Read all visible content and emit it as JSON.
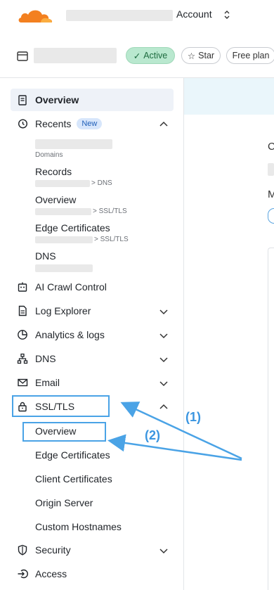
{
  "topbar": {
    "account_label": "Account",
    "chevron": "⌃⌄"
  },
  "zone": {
    "status": "Active",
    "star_label": "Star",
    "plan_label": "Free plan"
  },
  "sidebar": {
    "overview": "Overview",
    "recents": {
      "label": "Recents",
      "badge": "New",
      "items": [
        {
          "title": "",
          "sub": "Domains"
        },
        {
          "title": "Records",
          "sub": "> DNS"
        },
        {
          "title": "Overview",
          "sub": "> SSL/TLS"
        },
        {
          "title": "Edge Certificates",
          "sub": "> SSL/TLS"
        },
        {
          "title": "DNS",
          "sub": ""
        }
      ]
    },
    "items": {
      "ai_crawl": "AI Crawl Control",
      "log_explorer": "Log Explorer",
      "analytics": "Analytics & logs",
      "dns": "DNS",
      "email": "Email",
      "ssl": "SSL/TLS",
      "security": "Security",
      "access": "Access"
    },
    "ssl_sub": {
      "overview": "Overview",
      "edge": "Edge Certificates",
      "client": "Client Certificates",
      "origin": "Origin Server",
      "custom": "Custom Hostnames"
    }
  },
  "annotations": {
    "one": "(1)",
    "two": "(2)"
  },
  "content": {
    "c_letter": "C",
    "m_letter": "M"
  },
  "colors": {
    "annotation_blue": "#4aa3e6",
    "active_green_bg": "#b9e8cf",
    "cloudflare_orange": "#f38020"
  }
}
